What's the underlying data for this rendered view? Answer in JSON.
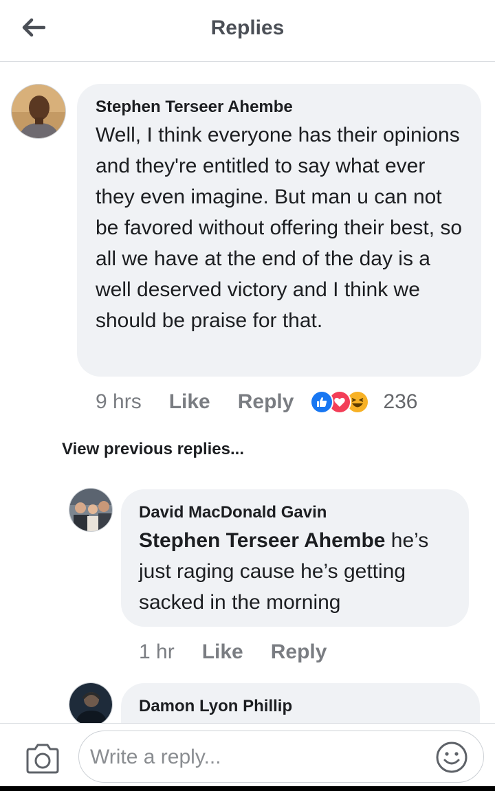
{
  "header": {
    "title": "Replies"
  },
  "main_comment": {
    "author": "Stephen Terseer Ahembe",
    "text": "Well, I think everyone has their opinions and they're entitled to say what ever they even imagine. But man u can not be favored without offering their best, so all we have at the end of the day is a well deserved victory and I think we should be praise for that.",
    "time": "9 hrs",
    "like_label": "Like",
    "reply_label": "Reply",
    "reaction_count": "236",
    "reactions": [
      "like-icon",
      "love-icon",
      "haha-icon"
    ]
  },
  "view_previous": "View previous replies...",
  "replies": [
    {
      "author": "David MacDonald Gavin",
      "mention": "Stephen Terseer Ahembe",
      "text": " he’s just raging cause he’s getting sacked in the morning",
      "time": "1 hr",
      "like_label": "Like",
      "reply_label": "Reply"
    },
    {
      "author": "Damon Lyon Phillip"
    }
  ],
  "composer": {
    "placeholder": "Write a reply..."
  },
  "colors": {
    "bubble": "#f0f2f5",
    "like": "#1877f2",
    "love": "#f33e58",
    "haha": "#f7b125",
    "muted": "#65676b"
  }
}
